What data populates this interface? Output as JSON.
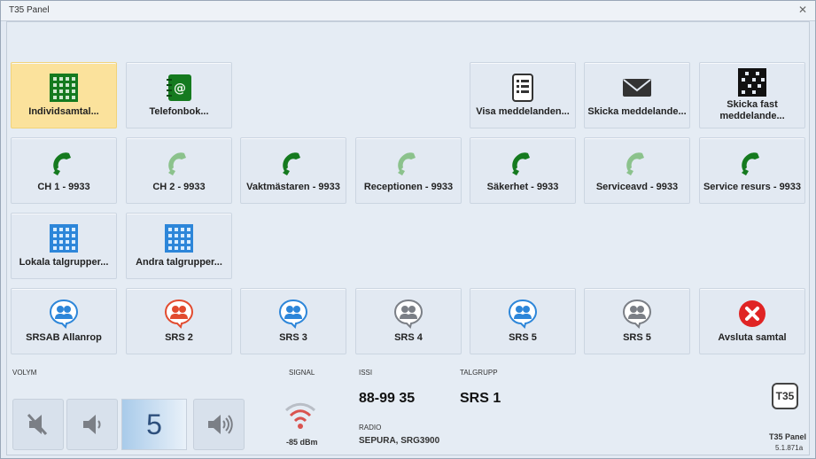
{
  "window": {
    "title": "T35 Panel",
    "close_icon": "close-icon"
  },
  "row1": [
    {
      "label": "Individsamtal...",
      "icon": "grid-icon",
      "selected": true
    },
    {
      "label": "Telefonbok...",
      "icon": "address-book-icon"
    },
    {
      "label": "Visa meddelanden...",
      "icon": "document-list-icon"
    },
    {
      "label": "Skicka meddelande...",
      "icon": "envelope-icon"
    },
    {
      "label_line1": "Skicka fast",
      "label_line2": "meddelande...",
      "icon": "checker-grid-icon"
    }
  ],
  "row2": [
    {
      "label": "CH 1 - 9933",
      "icon": "phone-icon",
      "state": "active"
    },
    {
      "label": "CH 2 - 9933",
      "icon": "phone-icon",
      "state": "inactive"
    },
    {
      "label": "Vaktmästaren - 9933",
      "icon": "phone-icon",
      "state": "active"
    },
    {
      "label": "Receptionen - 9933",
      "icon": "phone-icon",
      "state": "inactive"
    },
    {
      "label": "Säkerhet - 9933",
      "icon": "phone-icon",
      "state": "active"
    },
    {
      "label": "Serviceavd - 9933",
      "icon": "phone-icon",
      "state": "inactive"
    },
    {
      "label": "Service resurs - 9933",
      "icon": "phone-icon",
      "state": "active"
    }
  ],
  "row3": [
    {
      "label": "Lokala talgrupper...",
      "icon": "grid-icon-blue"
    },
    {
      "label": "Andra talgrupper...",
      "icon": "grid-icon-blue"
    }
  ],
  "row4": [
    {
      "label": "SRSAB Allanrop",
      "icon": "group-chat-icon",
      "state": "blue"
    },
    {
      "label": "SRS 2",
      "icon": "group-chat-icon",
      "state": "red"
    },
    {
      "label": "SRS 3",
      "icon": "group-chat-icon",
      "state": "blue"
    },
    {
      "label": "SRS 4",
      "icon": "group-chat-icon",
      "state": "gray"
    },
    {
      "label": "SRS 5",
      "icon": "group-chat-icon",
      "state": "blue"
    },
    {
      "label": "SRS 5",
      "icon": "group-chat-icon",
      "state": "gray"
    },
    {
      "label": "Avsluta samtal",
      "icon": "cancel-icon",
      "state": "red"
    }
  ],
  "bottom": {
    "volume_label": "VOLYM",
    "volume_value": "5",
    "signal_label": "SIGNAL",
    "signal_value": "-85 dBm",
    "issi_label": "ISSI",
    "issi_value": "88-99 35",
    "radio_label": "RADIO",
    "radio_value": "SEPURA, SRG3900",
    "talgrupp_label": "TALGRUPP",
    "talgrupp_value": "SRS 1",
    "logo_text": "T35",
    "app_name": "T35 Panel",
    "version": "5.1.871a"
  },
  "colors": {
    "green": "#157a1f",
    "green_light": "#8bc28c",
    "blue": "#2d86d9",
    "red": "#e24b2f",
    "gray": "#7b7f86",
    "selected": "#fbe29c"
  }
}
